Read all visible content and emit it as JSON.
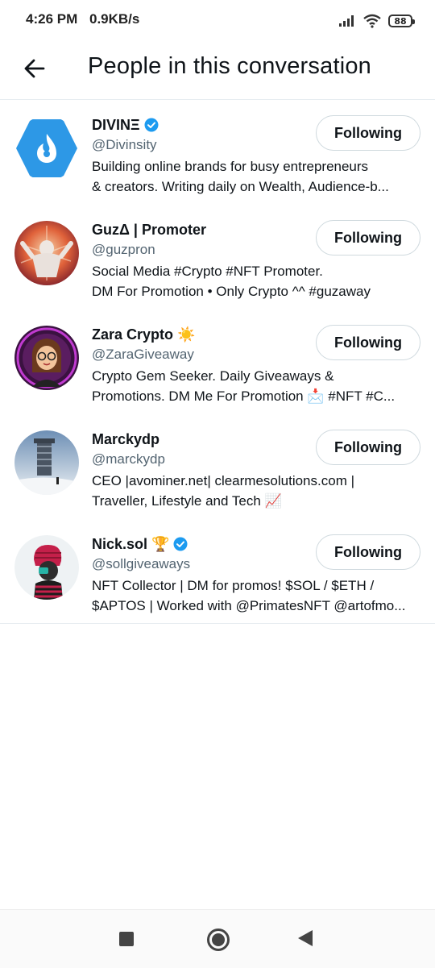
{
  "status_bar": {
    "time": "4:26 PM",
    "speed": "0.9KB/s",
    "battery": "88"
  },
  "header": {
    "title": "People in this conversation",
    "back_icon": "arrow-left-icon"
  },
  "accent_color": "#1d9bf0",
  "people": [
    {
      "name": "DIVINΞ",
      "verified": true,
      "handle": "@Divinsity",
      "bio_lines": [
        "Building online brands for busy entrepreneurs",
        "& creators. Writing daily on Wealth, Audience-b..."
      ],
      "button": "Following"
    },
    {
      "name": "GuzΔ | Promoter",
      "verified": false,
      "handle": "@guzpron",
      "bio_lines": [
        "Social Media #Crypto #NFT Promoter.",
        "DM For Promotion • Only Crypto ^^ #guzaway"
      ],
      "button": "Following"
    },
    {
      "name": "Zara Crypto",
      "emoji": "☀️",
      "verified": false,
      "handle": "@ZaraGiveaway",
      "bio_lines": [
        "Crypto Gem Seeker. Daily Giveaways &",
        "Promotions. DM Me For Promotion 📩 #NFT #C..."
      ],
      "button": "Following"
    },
    {
      "name": "Marckydp",
      "verified": false,
      "handle": "@marckydp",
      "bio_lines": [
        "CEO |avominer.net| clearmesolutions.com |",
        "Traveller, Lifestyle and Tech 📈"
      ],
      "button": "Following"
    },
    {
      "name": "Nick.sol",
      "emoji": "🏆",
      "verified": true,
      "handle": "@sollgiveaways",
      "bio_lines": [
        "NFT Collector | DM for promos! $SOL / $ETH /",
        "$APTOS | Worked with @PrimatesNFT @artofmo..."
      ],
      "button": "Following"
    }
  ]
}
